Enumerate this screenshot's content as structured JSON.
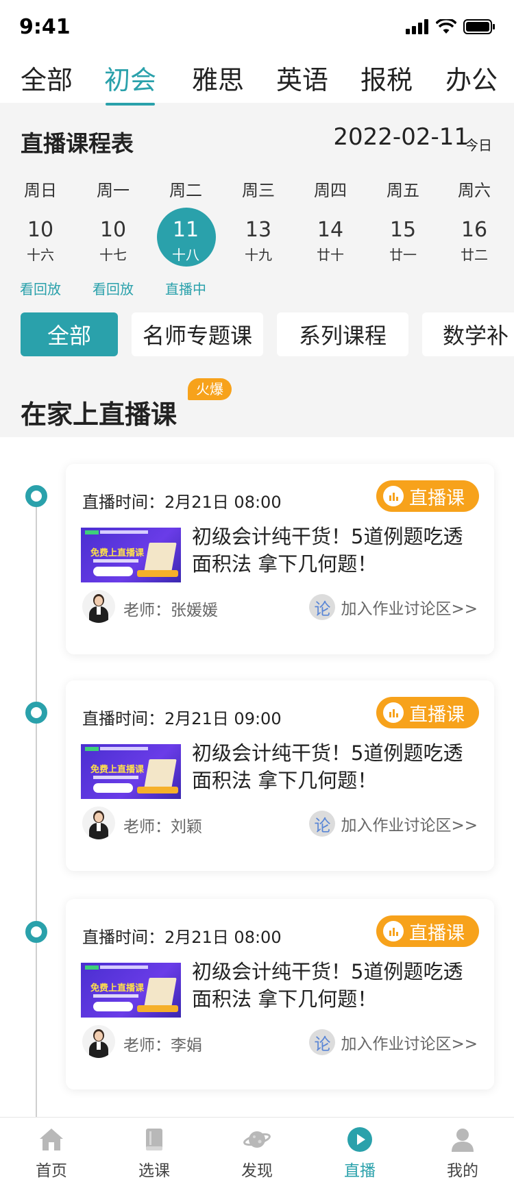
{
  "status": {
    "time": "9:41"
  },
  "top_tabs": [
    {
      "label": "全部"
    },
    {
      "label": "初会"
    },
    {
      "label": "雅思"
    },
    {
      "label": "英语"
    },
    {
      "label": "报税"
    },
    {
      "label": "办公"
    }
  ],
  "schedule": {
    "title": "直播课程表",
    "date": "2022-02-11",
    "today_label": "今日",
    "days": [
      {
        "weekday": "周日",
        "num": "10",
        "lunar": "十六",
        "status": "看回放"
      },
      {
        "weekday": "周一",
        "num": "10",
        "lunar": "十七",
        "status": "看回放"
      },
      {
        "weekday": "周二",
        "num": "11",
        "lunar": "十八",
        "status": "直播中"
      },
      {
        "weekday": "周三",
        "num": "13",
        "lunar": "十九",
        "status": ""
      },
      {
        "weekday": "周四",
        "num": "14",
        "lunar": "廿十",
        "status": ""
      },
      {
        "weekday": "周五",
        "num": "15",
        "lunar": "廿一",
        "status": ""
      },
      {
        "weekday": "周六",
        "num": "16",
        "lunar": "廿二",
        "status": ""
      }
    ]
  },
  "filters": [
    {
      "label": "全部"
    },
    {
      "label": "名师专题课"
    },
    {
      "label": "系列课程"
    },
    {
      "label": "数学补"
    }
  ],
  "section": {
    "title": "在家上直播课",
    "hot_label": "火爆"
  },
  "courses": [
    {
      "time_label": "直播时间：2月21日 08:00",
      "badge": "直播课",
      "thumb_text": "免费上直播课",
      "title": "初级会计纯干货！5道例题吃透面积法 拿下几何题！",
      "teacher": "老师：张媛媛",
      "discuss_icon": "论",
      "discuss": "加入作业讨论区>>"
    },
    {
      "time_label": "直播时间：2月21日 09:00",
      "badge": "直播课",
      "thumb_text": "免费上直播课",
      "title": "初级会计纯干货！5道例题吃透面积法 拿下几何题！",
      "teacher": "老师：刘颖",
      "discuss_icon": "论",
      "discuss": "加入作业讨论区>>"
    },
    {
      "time_label": "直播时间：2月21日 08:00",
      "badge": "直播课",
      "thumb_text": "免费上直播课",
      "title": "初级会计纯干货！5道例题吃透面积法 拿下几何题！",
      "teacher": "老师：李娟",
      "discuss_icon": "论",
      "discuss": "加入作业讨论区>>"
    }
  ],
  "bottom_nav": [
    {
      "label": "首页",
      "icon": "home-icon"
    },
    {
      "label": "选课",
      "icon": "book-icon"
    },
    {
      "label": "发现",
      "icon": "planet-icon"
    },
    {
      "label": "直播",
      "icon": "play-icon"
    },
    {
      "label": "我的",
      "icon": "user-icon"
    }
  ],
  "colors": {
    "accent": "#2aa1ab",
    "badge": "#f7a21b",
    "section_bg": "#f4f4f4"
  }
}
